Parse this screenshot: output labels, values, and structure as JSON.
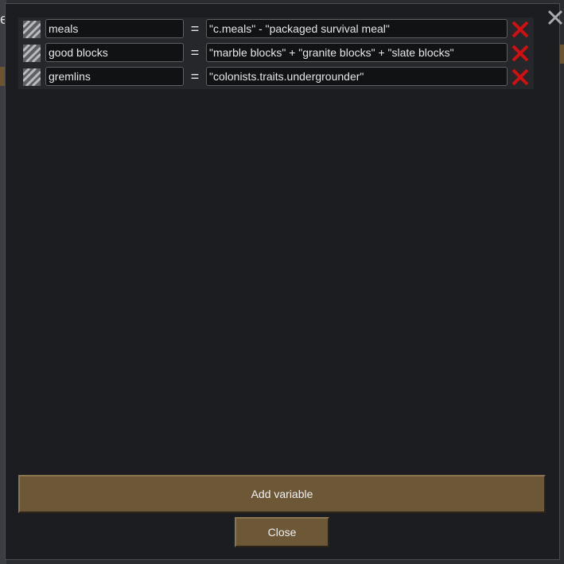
{
  "dialog": {
    "close_icon": "close-icon",
    "add_label": "Add variable",
    "close_label": "Close"
  },
  "variables": [
    {
      "name": "meals",
      "operator": "=",
      "expression": "\"c.meals\" - \"packaged survival meal\""
    },
    {
      "name": "good blocks",
      "operator": "=",
      "expression": "\"marble blocks\" + \"granite blocks\" + \"slate blocks\""
    },
    {
      "name": "gremlins",
      "operator": "=",
      "expression": "\"colonists.traits.undergrounder\""
    }
  ],
  "background": {
    "peek_text": "e"
  },
  "colors": {
    "button": "#6c5836",
    "delete": "#d01010"
  }
}
